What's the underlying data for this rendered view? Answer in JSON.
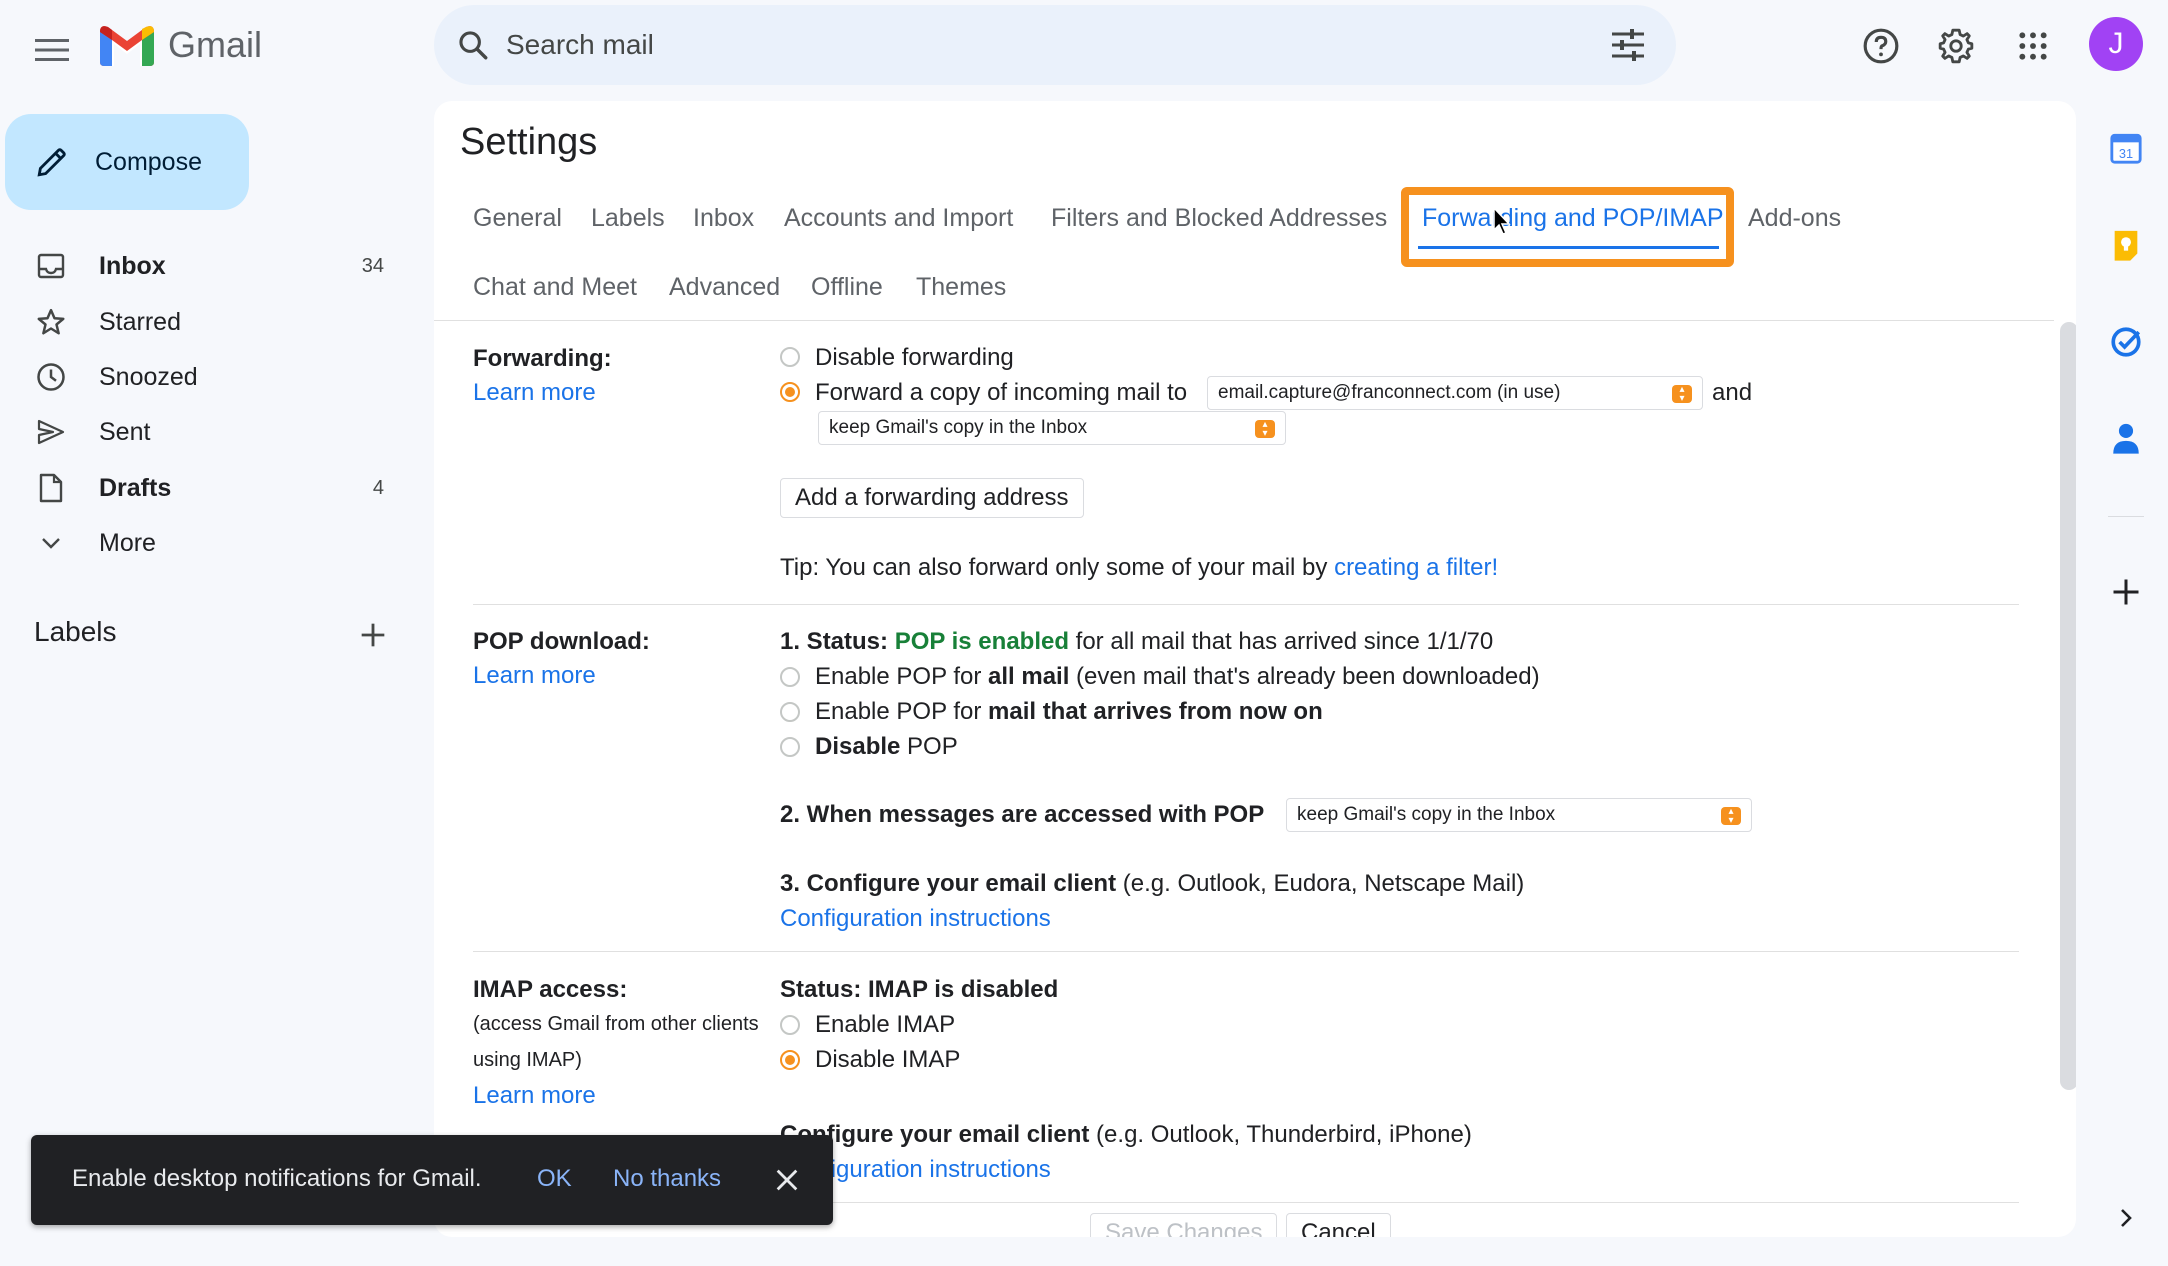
{
  "app": {
    "name": "Gmail"
  },
  "search": {
    "placeholder": "Search mail"
  },
  "account": {
    "initial": "J",
    "avatar_color": "#a142f4"
  },
  "compose": {
    "label": "Compose"
  },
  "nav": [
    {
      "label": "Inbox",
      "count": "34",
      "icon": "inbox-icon"
    },
    {
      "label": "Starred",
      "count": "",
      "icon": "star-icon"
    },
    {
      "label": "Snoozed",
      "count": "",
      "icon": "clock-icon"
    },
    {
      "label": "Sent",
      "count": "",
      "icon": "send-icon"
    },
    {
      "label": "Drafts",
      "count": "4",
      "icon": "draft-icon"
    },
    {
      "label": "More",
      "count": "",
      "icon": "chevron-down-icon"
    }
  ],
  "labels": {
    "heading": "Labels"
  },
  "settings": {
    "title": "Settings",
    "tabs": [
      "General",
      "Labels",
      "Inbox",
      "Accounts and Import",
      "Filters and Blocked Addresses",
      "Forwarding and POP/IMAP",
      "Add-ons",
      "Chat and Meet",
      "Advanced",
      "Offline",
      "Themes"
    ],
    "active_tab": "Forwarding and POP/IMAP",
    "forwarding": {
      "label": "Forwarding:",
      "learn_more": "Learn more",
      "option_disable": "Disable forwarding",
      "option_forward": "Forward a copy of incoming mail to",
      "address": "email.capture@franconnect.com (in use)",
      "and": "and",
      "action": "keep Gmail's copy in the Inbox",
      "add_button": "Add a forwarding address",
      "tip_prefix": "Tip: You can also forward only some of your mail by ",
      "tip_link": "creating a filter!"
    },
    "pop": {
      "label": "POP download:",
      "learn_more": "Learn more",
      "status_prefix": "1. Status: ",
      "status_value": "POP is enabled",
      "status_suffix": " for all mail that has arrived since 1/1/70",
      "opt1_a": "Enable POP for ",
      "opt1_b": "all mail",
      "opt1_c": " (even mail that's already been downloaded)",
      "opt2_a": "Enable POP for ",
      "opt2_b": "mail that arrives from now on",
      "opt3_a": "Disable",
      "opt3_b": " POP",
      "when_label": "2. When messages are accessed with POP",
      "when_value": "keep Gmail's copy in the Inbox",
      "configure_bold": "3. Configure your email client",
      "configure_rest": " (e.g. Outlook, Eudora, Netscape Mail)",
      "config_link": "Configuration instructions"
    },
    "imap": {
      "label": "IMAP access:",
      "desc1": "(access Gmail from other clients",
      "desc2": "using IMAP)",
      "learn_more": "Learn more",
      "status": "Status: IMAP is disabled",
      "opt_enable": "Enable IMAP",
      "opt_disable": "Disable IMAP",
      "configure_bold": "Configure your email client",
      "configure_rest": " (e.g. Outlook, Thunderbird, iPhone)",
      "config_link": "Configuration instructions"
    },
    "save": "Save Changes",
    "cancel": "Cancel"
  },
  "snackbar": {
    "message": "Enable desktop notifications for Gmail.",
    "ok": "OK",
    "no_thanks": "No thanks"
  },
  "colors": {
    "accent": "#1a73e8",
    "highlight": "#f6911e",
    "compose_bg": "#c2e7ff"
  }
}
